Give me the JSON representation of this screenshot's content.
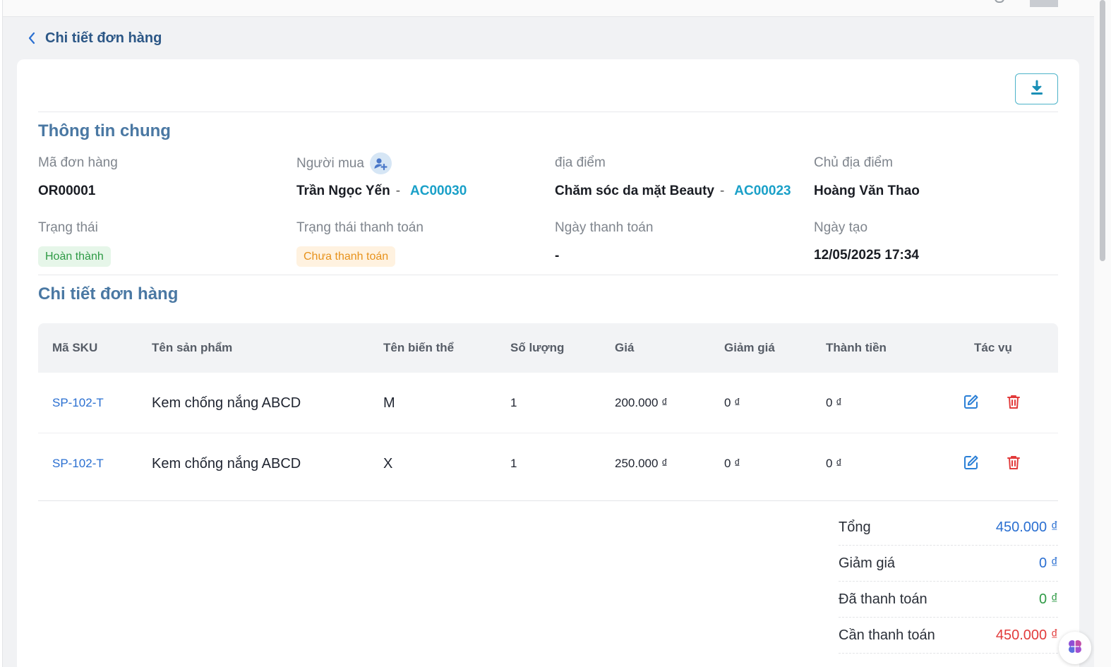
{
  "header": {
    "title": "Chi tiết đơn hàng"
  },
  "general": {
    "section_title": "Thông tin chung",
    "order_code_label": "Mã đơn hàng",
    "order_code": "OR00001",
    "buyer_label": "Người mua",
    "buyer_name": "Trần Ngọc Yến",
    "buyer_code": "AC00030",
    "location_label": "địa điểm",
    "location_name": "Chăm sóc da mặt Beauty",
    "location_code": "AC00023",
    "owner_label": "Chủ địa điểm",
    "owner_name": "Hoàng Văn Thao",
    "status_label": "Trạng thái",
    "status_value": "Hoàn thành",
    "payment_status_label": "Trạng thái thanh toán",
    "payment_status_value": "Chưa thanh toán",
    "payment_date_label": "Ngày thanh toán",
    "payment_date_value": "-",
    "created_label": "Ngày tạo",
    "created_value": "12/05/2025 17:34",
    "separator": "-"
  },
  "details": {
    "section_title": "Chi tiết đơn hàng",
    "columns": [
      "Mã SKU",
      "Tên sản phẩm",
      "Tên biến thể",
      "Số lượng",
      "Giá",
      "Giảm giá",
      "Thành tiền",
      "Tác vụ"
    ],
    "rows": [
      {
        "sku": "SP-102-T",
        "name": "Kem chống nắng ABCD",
        "variant": "M",
        "qty": "1",
        "price": "200.000 ₫",
        "discount": "0 ₫",
        "total": "0 ₫"
      },
      {
        "sku": "SP-102-T",
        "name": "Kem chống nắng ABCD",
        "variant": "X",
        "qty": "1",
        "price": "250.000 ₫",
        "discount": "0 ₫",
        "total": "0 ₫"
      }
    ]
  },
  "summary": {
    "total_label": "Tổng",
    "total_value": "450.000 ₫",
    "discount_label": "Giảm giá",
    "discount_value": "0 ₫",
    "paid_label": "Đã thanh toán",
    "paid_value": "0 ₫",
    "due_label": "Cần thanh toán",
    "due_value": "450.000 ₫"
  },
  "colors": {
    "accent": "#4a78a3",
    "link": "#2a6fd1",
    "code": "#1aa0c8",
    "success": "#2e9a45",
    "warning": "#e7921c",
    "danger": "#e23b3b"
  },
  "icons": {
    "back": "chevron-left-icon",
    "download": "download-icon",
    "buyer": "user-add-icon",
    "edit": "edit-icon",
    "delete": "trash-icon",
    "assistant": "brain-icon"
  }
}
